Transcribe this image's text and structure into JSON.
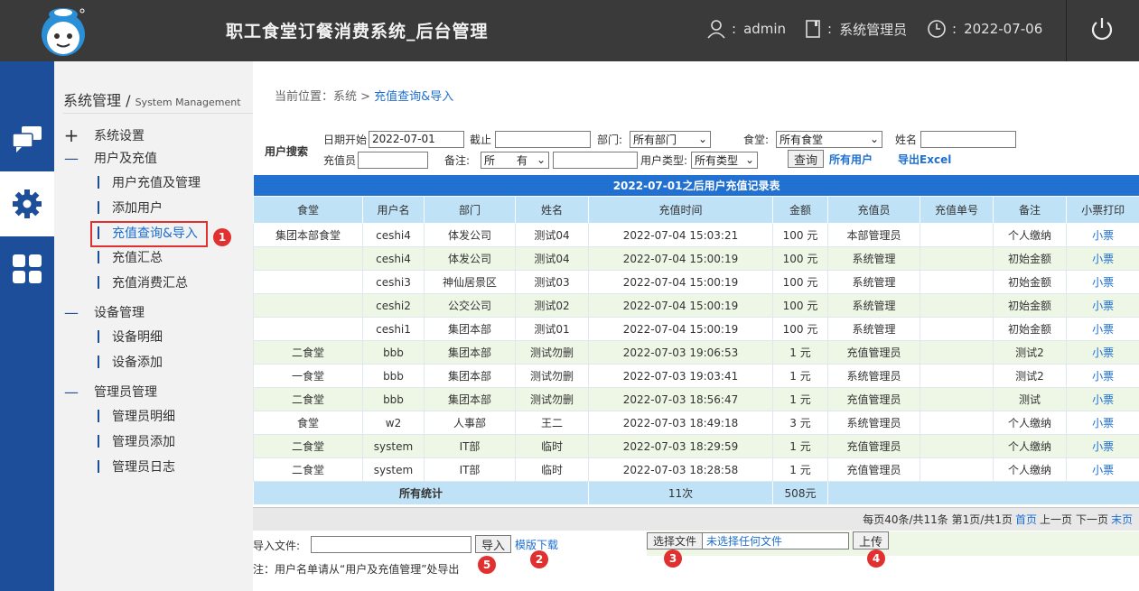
{
  "header": {
    "title": "职工食堂订餐消费系统_后台管理",
    "user_label": ":",
    "user": "admin",
    "role_label": ":",
    "role": "系统管理员",
    "date_label": ":",
    "date": "2022-07-06",
    "icons": [
      "user-icon",
      "document-icon",
      "clock-icon",
      "power-icon"
    ]
  },
  "rail": {
    "icons": [
      "chat-icon",
      "gear-icon",
      "grid-icon"
    ],
    "active": "gear-icon",
    "accent": "#1d4e9a"
  },
  "sidebar": {
    "title": "系统管理 /",
    "title_en": "System Management",
    "groups": [
      {
        "mark": "+",
        "label": "系统设置",
        "items": []
      },
      {
        "mark": "—",
        "label": "用户及充值",
        "items": [
          "用户充值及管理",
          "添加用户",
          "充值查询&导入",
          "充值汇总",
          "充值消费汇总"
        ]
      },
      {
        "mark": "—",
        "label": "设备管理",
        "items": [
          "设备明细",
          "设备添加"
        ]
      },
      {
        "mark": "—",
        "label": "管理员管理",
        "items": [
          "管理员明细",
          "管理员添加",
          "管理员日志"
        ]
      }
    ],
    "active_item": "充值查询&导入"
  },
  "badges": [
    "1",
    "2",
    "3",
    "4",
    "5"
  ],
  "breadcrumb": {
    "prefix": "当前位置：系统 > ",
    "current": "充值查询&导入"
  },
  "search": {
    "title": "用户搜索",
    "date_start_label": "日期开始",
    "date_start": "2022-07-01",
    "date_end_label": "截止",
    "date_end": "",
    "dept_label": "部门:",
    "dept": "所有部门",
    "canteen_label": "食堂:",
    "canteen": "所有食堂",
    "name_label": "姓名",
    "name": "",
    "operator_label": "充值员",
    "operator": "",
    "remark_label": "备注:",
    "remark_select": "所　　有",
    "remark": "",
    "usertype_label": "用户类型:",
    "usertype": "所有类型",
    "query_button": "查询",
    "all_users_link": "所有用户",
    "export_link": "导出Excel"
  },
  "table": {
    "caption": "2022-07-01之后用户充值记录表",
    "columns": [
      "食堂",
      "用户名",
      "部门",
      "姓名",
      "充值时间",
      "金额",
      "充值员",
      "充值单号",
      "备注",
      "小票打印"
    ],
    "rows": [
      [
        "集团本部食堂",
        "ceshi4",
        "体发公司",
        "测试04",
        "2022-07-04 15:03:21",
        "100 元",
        "本部管理员",
        "",
        "个人缴纳",
        "小票"
      ],
      [
        "",
        "ceshi4",
        "体发公司",
        "测试04",
        "2022-07-04 15:00:19",
        "100 元",
        "系统管理",
        "",
        "初始金额",
        "小票"
      ],
      [
        "",
        "ceshi3",
        "神仙居景区",
        "测试03",
        "2022-07-04 15:00:19",
        "100 元",
        "系统管理",
        "",
        "初始金额",
        "小票"
      ],
      [
        "",
        "ceshi2",
        "公交公司",
        "测试02",
        "2022-07-04 15:00:19",
        "100 元",
        "系统管理",
        "",
        "初始金额",
        "小票"
      ],
      [
        "",
        "ceshi1",
        "集团本部",
        "测试01",
        "2022-07-04 15:00:19",
        "100 元",
        "系统管理",
        "",
        "初始金额",
        "小票"
      ],
      [
        "二食堂",
        "bbb",
        "集团本部",
        "测试勿删",
        "2022-07-03 19:06:53",
        "1 元",
        "充值管理员",
        "",
        "测试2",
        "小票"
      ],
      [
        "一食堂",
        "bbb",
        "集团本部",
        "测试勿删",
        "2022-07-03 19:03:41",
        "1 元",
        "系统管理员",
        "",
        "测试2",
        "小票"
      ],
      [
        "二食堂",
        "bbb",
        "集团本部",
        "测试勿删",
        "2022-07-03 18:56:47",
        "1 元",
        "充值管理员",
        "",
        "测试",
        "小票"
      ],
      [
        "食堂",
        "w2",
        "人事部",
        "王二",
        "2022-07-03 18:49:18",
        "3 元",
        "系统管理员",
        "",
        "个人缴纳",
        "小票"
      ],
      [
        "二食堂",
        "system",
        "IT部",
        "临时",
        "2022-07-03 18:29:59",
        "1 元",
        "充值管理员",
        "",
        "个人缴纳",
        "小票"
      ],
      [
        "二食堂",
        "system",
        "IT部",
        "临时",
        "2022-07-03 18:28:58",
        "1 元",
        "充值管理员",
        "",
        "个人缴纳",
        "小票"
      ]
    ],
    "summary": {
      "label": "所有统计",
      "count": "11次",
      "total": "508元"
    }
  },
  "pager": {
    "info": "每页40条/共11条 第1页/共1页",
    "first": "首页",
    "prev": "上一页",
    "next": "下一页",
    "last": "末页"
  },
  "import": {
    "label": "导入文件:",
    "value": "",
    "import_button": "导入",
    "template_link": "模版下载",
    "choose_button": "选择文件",
    "no_file_text": "未选择任何文件",
    "upload_button": "上传",
    "note": "注：用户名单请从“用户及充值管理”处导出"
  }
}
